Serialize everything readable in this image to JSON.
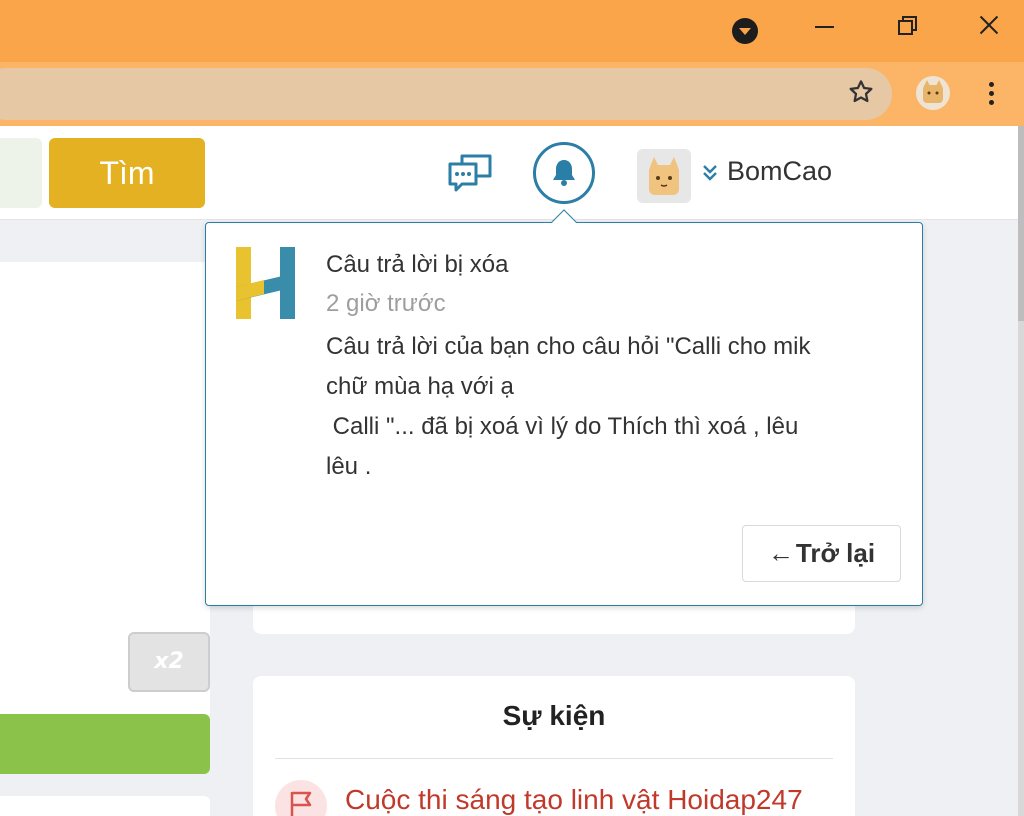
{
  "browser": {
    "icons": [
      "tab-search-icon",
      "minimize-icon",
      "restore-icon",
      "close-icon",
      "star-icon",
      "profile-avatar",
      "kebab-menu-icon"
    ]
  },
  "header": {
    "search_button_label": "Tìm",
    "username": "BomCao",
    "icons": [
      "chat-icon",
      "bell-icon",
      "avatar",
      "chevron-down-icon"
    ],
    "accent_color": "#2b7ea6",
    "search_button_color": "#e3b121"
  },
  "notification": {
    "title": "Câu trả lời bị xóa",
    "time": "2 giờ trước",
    "body_lines": [
      "Câu trả lời của bạn cho câu hỏi \"Calli cho mik",
      "chữ mùa hạ với ạ",
      " Calli \"... đã bị xoá vì lý do Thích thì xoá , lêu",
      "lêu ."
    ],
    "back_arrow": "←",
    "back_label": "Trở lại"
  },
  "sidebar_left": {
    "x2_label": "x2"
  },
  "events": {
    "title": "Sự kiện",
    "items": [
      {
        "label": "Cuộc thi sáng tạo linh vật Hoidap247"
      }
    ]
  }
}
